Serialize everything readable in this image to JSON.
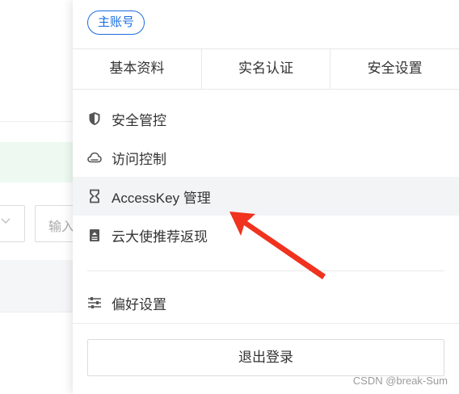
{
  "background": {
    "input_placeholder": "输入"
  },
  "panel": {
    "badge": "主账号",
    "tabs": [
      "基本资料",
      "实名认证",
      "安全设置"
    ],
    "menu": [
      {
        "label": "安全管控",
        "icon": "shield-icon"
      },
      {
        "label": "访问控制",
        "icon": "cloud-icon"
      },
      {
        "label": "AccessKey 管理",
        "icon": "key-icon",
        "highlighted": true
      },
      {
        "label": "云大使推荐返现",
        "icon": "document-icon"
      }
    ],
    "preferences": {
      "label": "偏好设置",
      "icon": "sliders-icon"
    },
    "logout": "退出登录"
  },
  "annotation": {
    "arrow_color": "#f0321e"
  },
  "watermark": "CSDN @break-Sum"
}
